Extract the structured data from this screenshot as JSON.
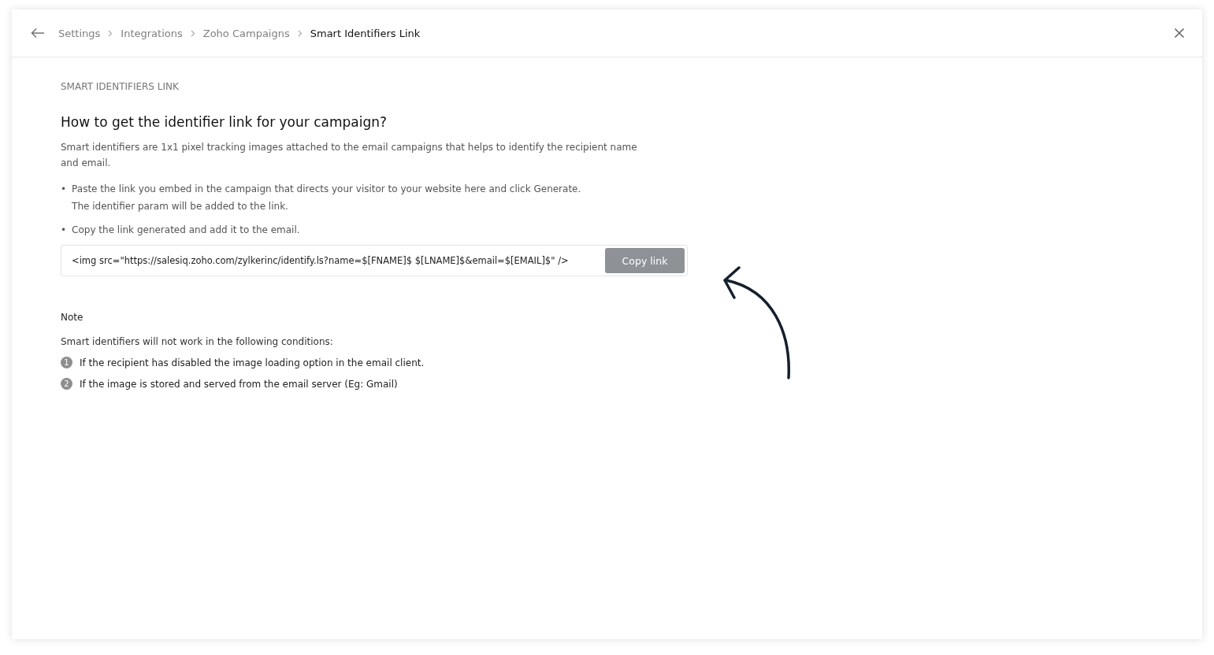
{
  "breadcrumbs": [
    {
      "label": "Settings",
      "current": false
    },
    {
      "label": "Integrations",
      "current": false
    },
    {
      "label": "Zoho Campaigns",
      "current": false
    },
    {
      "label": "Smart Identifiers Link",
      "current": true
    }
  ],
  "section_label": "SMART IDENTIFIERS LINK",
  "heading": "How to get the identifier link for your campaign?",
  "intro": "Smart identifiers are 1x1 pixel tracking images attached to the email campaigns that helps to identify the recipient name and email.",
  "steps": [
    {
      "marker": "•",
      "text": "Paste the link you embed in the campaign that directs your visitor to your website here and click Generate. The identifier param will be added to the link."
    },
    {
      "marker": "•",
      "text": "Copy the link generated and add it to the email."
    }
  ],
  "link_field": {
    "value": "<img src=\"https://salesiq.zoho.com/zylkerinc/identify.ls?name=$[FNAME]$ $[LNAME]$&email=$[EMAIL]$\" />",
    "button": "Copy link",
    "disabled": true
  },
  "note": {
    "title": "Note",
    "text": "Smart identifiers will not work in the following conditions:",
    "conditions": [
      {
        "number": "1",
        "text": "If the recipient has disabled the image loading option in the email client."
      },
      {
        "number": "2",
        "text": "If the image is stored and served from the email server (Eg: Gmail)"
      }
    ]
  }
}
